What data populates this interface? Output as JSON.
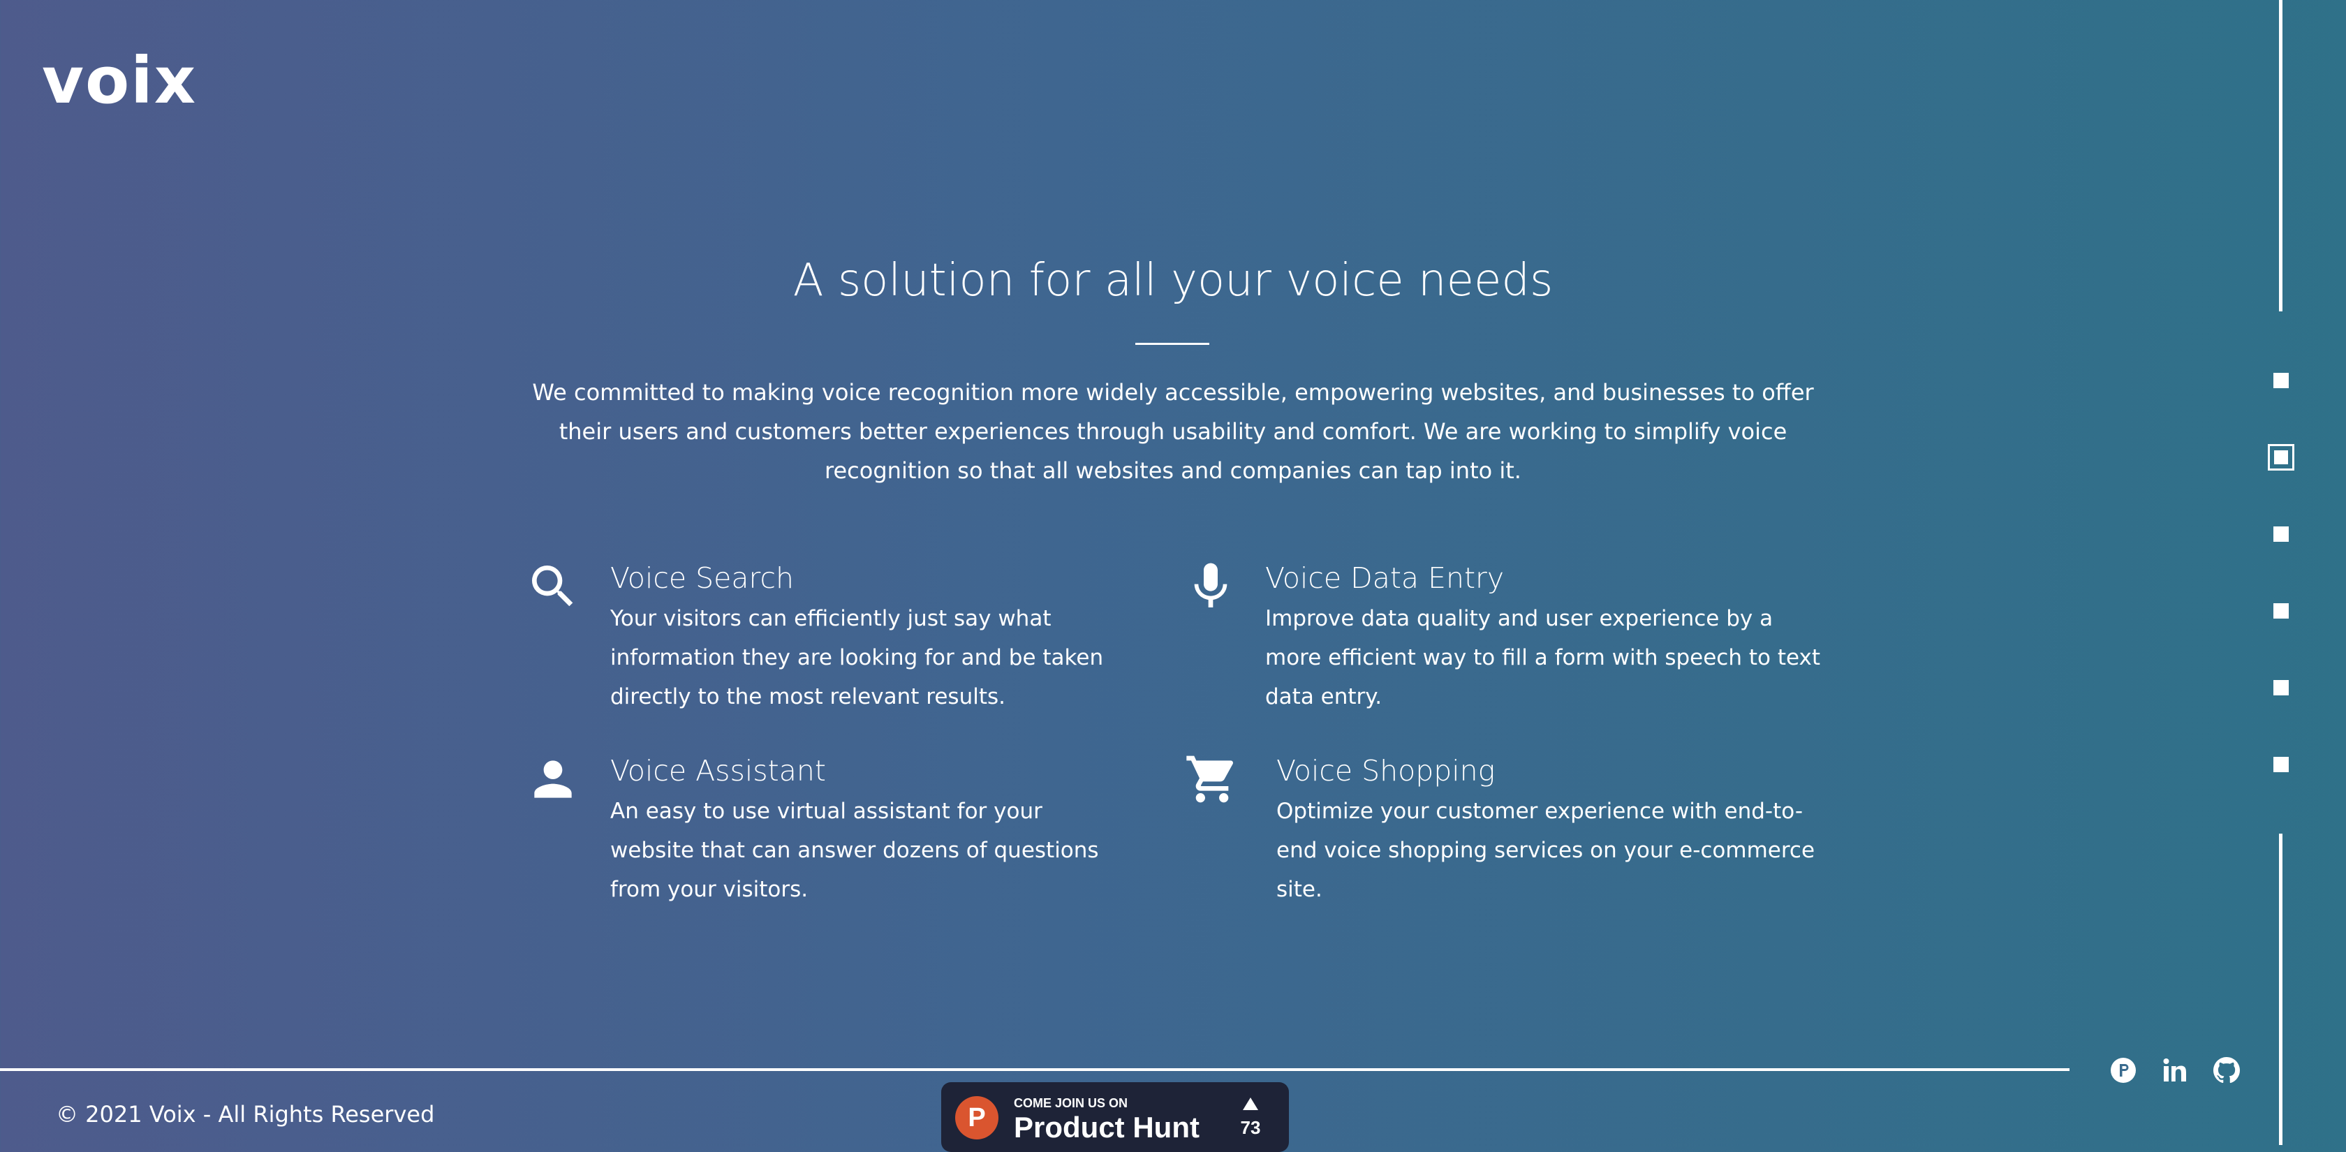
{
  "brand": {
    "logo_text": "voix"
  },
  "hero": {
    "title": "A solution for all your voice needs",
    "intro": "We committed to making voice recognition more widely accessible, empowering websites, and businesses to offer their users and customers better experiences through usability and comfort. We are working to simplify voice recognition so that all websites and companies can tap into it."
  },
  "features": [
    {
      "icon": "search-icon",
      "title": "Voice Search",
      "description": "Your visitors can efficiently just say what information they are looking for and be taken directly to the most relevant results."
    },
    {
      "icon": "microphone-icon",
      "title": "Voice Data Entry",
      "description": "Improve data quality and user experience by a more efficient way to fill a form with speech to text data entry."
    },
    {
      "icon": "person-icon",
      "title": "Voice Assistant",
      "description": "An easy to use virtual assistant for your website that can answer dozens of questions from your visitors."
    },
    {
      "icon": "shopping-cart-icon",
      "title": "Voice Shopping",
      "description": "Optimize your customer experience with end-to-end voice shopping services on your e-commerce site."
    }
  ],
  "section_nav": {
    "active_index": 1,
    "count": 6
  },
  "footer": {
    "copyright": "© 2021 Voix - All Rights Reserved",
    "product_hunt": {
      "small_text": "COME JOIN US ON",
      "big_text": "Product Hunt",
      "logo_letter": "P",
      "upvotes": "73"
    },
    "social": [
      "product-hunt-icon",
      "linkedin-icon",
      "github-icon"
    ]
  },
  "colors": {
    "background_start": "#4e5b8c",
    "background_end": "#2f7189",
    "text": "#ffffff",
    "product_hunt_badge": "#1e2337",
    "product_hunt_orange": "#da552f"
  }
}
